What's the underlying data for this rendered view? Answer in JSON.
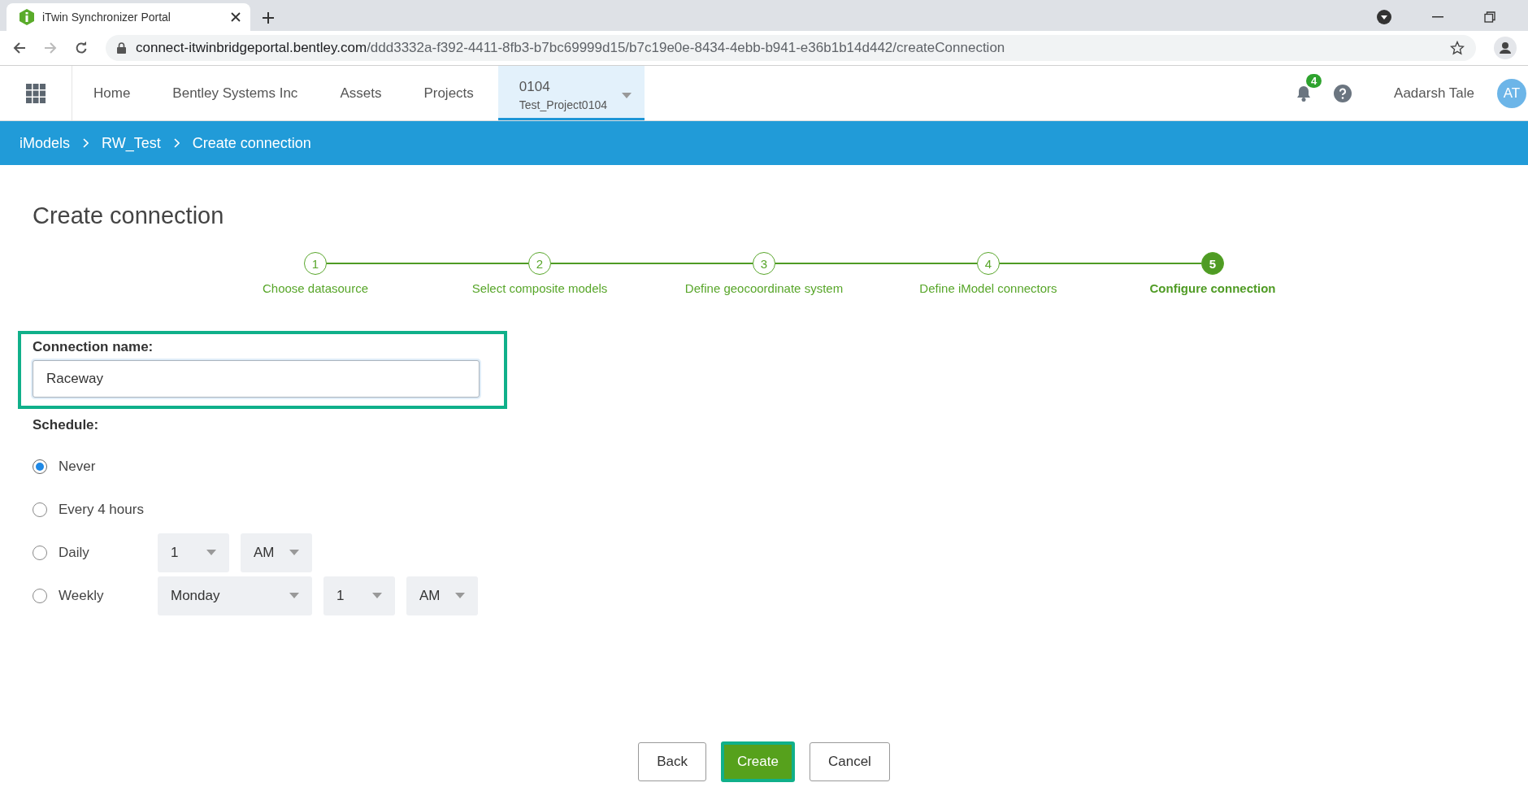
{
  "browser": {
    "tab_title": "iTwin Synchronizer Portal",
    "url_domain": "connect-itwinbridgeportal.bentley.com",
    "url_path": "/ddd3332a-f392-4411-8fb3-b7bc69999d15/b7c19e0e-8434-4ebb-b941-e36b1b14d442/createConnection"
  },
  "header": {
    "nav": [
      {
        "label": "Home"
      },
      {
        "label": "Bentley Systems Inc"
      },
      {
        "label": "Assets"
      },
      {
        "label": "Projects"
      }
    ],
    "project": {
      "code": "0104",
      "name": "Test_Project0104"
    },
    "notification_count": "4",
    "user_name": "Aadarsh Tale",
    "avatar_initials": "AT"
  },
  "breadcrumb": [
    "iModels",
    "RW_Test",
    "Create connection"
  ],
  "page_title": "Create connection",
  "steps": [
    {
      "number": "1",
      "label": "Choose datasource",
      "selected": false
    },
    {
      "number": "2",
      "label": "Select composite models",
      "selected": false
    },
    {
      "number": "3",
      "label": "Define geocoordinate system",
      "selected": false
    },
    {
      "number": "4",
      "label": "Define iModel connectors",
      "selected": false
    },
    {
      "number": "5",
      "label": "Configure connection",
      "selected": true
    }
  ],
  "connection_name": {
    "label": "Connection name:",
    "value": "Raceway"
  },
  "schedule": {
    "label": "Schedule:",
    "options": [
      {
        "label": "Never",
        "selected": true
      },
      {
        "label": "Every 4 hours",
        "selected": false
      },
      {
        "label": "Daily",
        "selected": false,
        "dropdowns": [
          {
            "value": "1",
            "kind": "short"
          },
          {
            "value": "AM",
            "kind": "short"
          }
        ]
      },
      {
        "label": "Weekly",
        "selected": false,
        "dropdowns": [
          {
            "value": "Monday",
            "kind": "wide"
          },
          {
            "value": "1",
            "kind": "short"
          },
          {
            "value": "AM",
            "kind": "short"
          }
        ]
      }
    ]
  },
  "buttons": [
    {
      "label": "Back",
      "kind": "secondary"
    },
    {
      "label": "Create",
      "kind": "primary"
    },
    {
      "label": "Cancel",
      "kind": "secondary"
    }
  ]
}
